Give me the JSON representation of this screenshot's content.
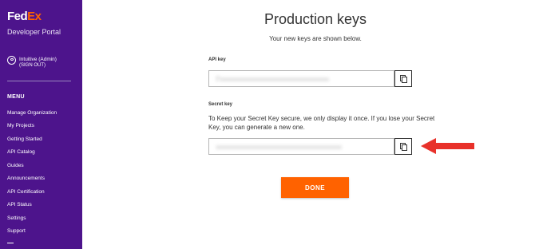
{
  "sidebar": {
    "logo": {
      "part1": "Fed",
      "part2": "Ex"
    },
    "portal_title": "Developer Portal",
    "user": {
      "name": "Intuitive (Admin)",
      "sign_out": "(SIGN OUT)"
    },
    "menu_heading": "MENU",
    "items": [
      {
        "label": "Manage Organization"
      },
      {
        "label": "My Projects"
      },
      {
        "label": "Getting Started"
      },
      {
        "label": "API Catalog"
      },
      {
        "label": "Guides"
      },
      {
        "label": "Announcements"
      },
      {
        "label": "API Certification"
      },
      {
        "label": "API Status"
      },
      {
        "label": "Settings"
      },
      {
        "label": "Support"
      }
    ]
  },
  "main": {
    "title": "Production keys",
    "subtitle": "Your new keys are shown below.",
    "api_key": {
      "label": "API key",
      "value": "l7xxxxxxxxxxxxxxxxxxxxxxxxxxxxxxxxxxxxxxx"
    },
    "secret_key": {
      "label": "Secret key",
      "description": "To Keep your Secret Key secure, we only display it once. If you lose your Secret Key, you can generate a new one.",
      "value": "xxxxxxxxxxxxxxxxxxxxxxxxxxxxxxxxxxxxxxxxxxxxx"
    },
    "done_label": "DONE"
  },
  "colors": {
    "sidebar_bg": "#4d148c",
    "brand_orange": "#ff6200",
    "arrow": "#e8312a"
  },
  "icons": {
    "user": "user-circle-icon",
    "copy": "copy-icon",
    "arrow": "arrow-left-icon"
  }
}
